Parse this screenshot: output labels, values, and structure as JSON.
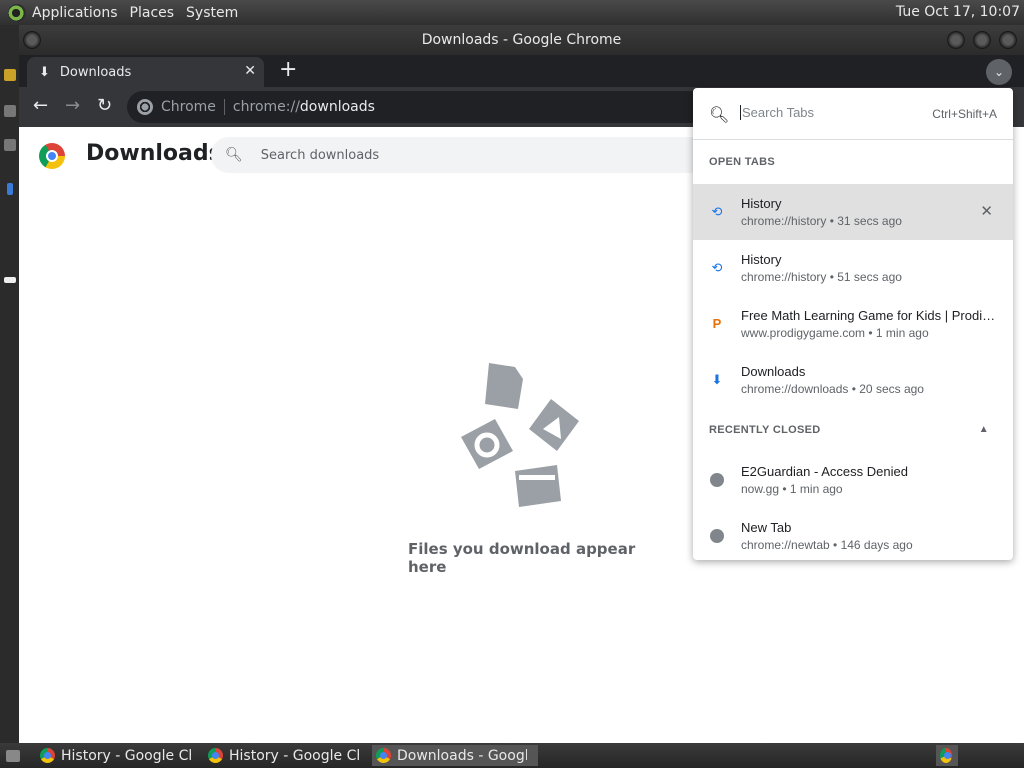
{
  "top_panel": {
    "menus": [
      "Applications",
      "Places",
      "System"
    ],
    "clock": "Tue Oct 17, 10:07"
  },
  "window": {
    "title": "Downloads - Google Chrome"
  },
  "tab": {
    "label": "Downloads"
  },
  "omnibox": {
    "chip": "Chrome",
    "url_prefix": "chrome://",
    "url_path": "downloads"
  },
  "page": {
    "title": "Downloads",
    "search_placeholder": "Search downloads",
    "empty_message": "Files you download appear here"
  },
  "tab_search": {
    "placeholder": "Search Tabs",
    "shortcut": "Ctrl+Shift+A",
    "open_tabs_heading": "OPEN TABS",
    "open_tabs": [
      {
        "title": "History",
        "subtitle": "chrome://history • 31 secs ago",
        "icon": "history-icon"
      },
      {
        "title": "History",
        "subtitle": "chrome://history • 51 secs ago",
        "icon": "history-icon"
      },
      {
        "title": "Free Math Learning Game for Kids | Prodigy Education",
        "subtitle": "www.prodigygame.com • 1 min ago",
        "icon": "prodigy-icon"
      },
      {
        "title": "Downloads",
        "subtitle": "chrome://downloads • 20 secs ago",
        "icon": "download-icon"
      }
    ],
    "recently_closed_heading": "RECENTLY CLOSED",
    "recently_closed": [
      {
        "title": "E2Guardian - Access Denied",
        "subtitle": "now.gg • 1 min ago",
        "icon": "globe-icon"
      },
      {
        "title": "New Tab",
        "subtitle": "chrome://newtab • 146 days ago",
        "icon": "globe-icon"
      }
    ]
  },
  "taskbar": {
    "tasks": [
      "History - Google Ch...",
      "History - Google Ch...",
      "Downloads - Googl..."
    ]
  }
}
